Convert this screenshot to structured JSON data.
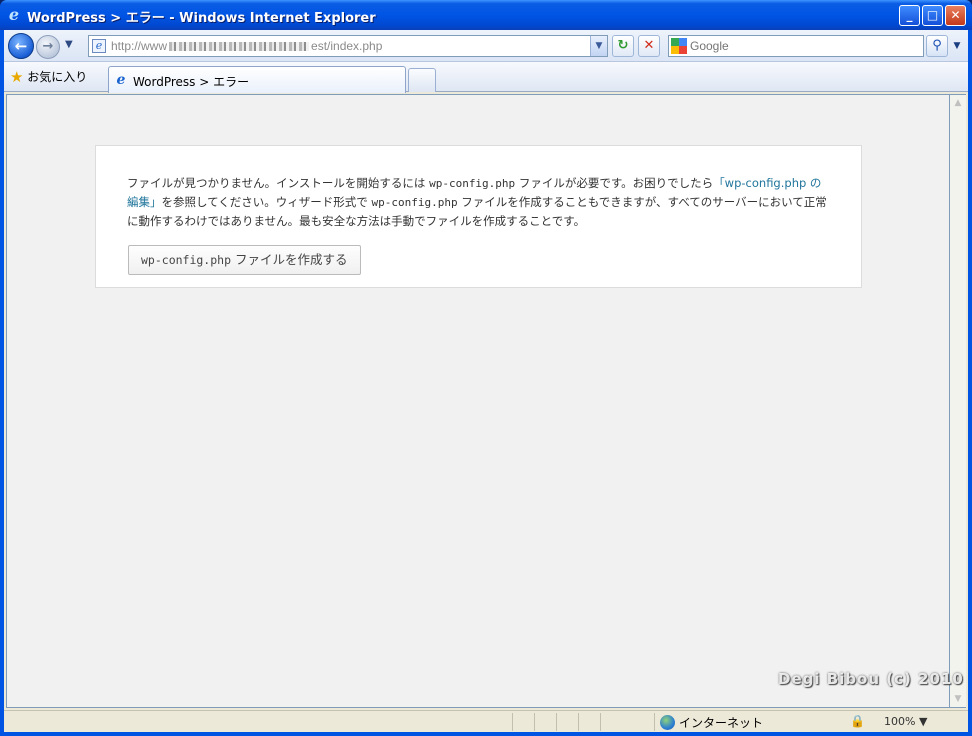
{
  "window": {
    "title": "WordPress > エラー - Windows Internet Explorer",
    "buttons": {
      "minimize": "_",
      "maximize": "□",
      "close": "✕"
    }
  },
  "navbar": {
    "address_prefix": "http://www",
    "address_suffix": "est/index.php",
    "search_placeholder": "Google",
    "back_glyph": "←",
    "forward_glyph": "→",
    "refresh_glyph": "↻",
    "stop_glyph": "✕",
    "search_glyph": "⚲"
  },
  "favorites": {
    "label": "お気に入り",
    "tab_label": "WordPress > エラー"
  },
  "page": {
    "msg_part1": "ファイルが見つかりません。インストールを開始するには ",
    "msg_code1": "wp-config.php",
    "msg_part2": " ファイルが必要です。お困りでしたら",
    "msg_link": "「wp-config.php の編集」",
    "msg_part3": "を参照してください。ウィザード形式で ",
    "msg_code2": "wp-config.php",
    "msg_part4": " ファイルを作成することもできますが、すべてのサーバーにおいて正常に動作するわけではありません。最も安全な方法は手動でファイルを作成することです。",
    "button_code": "wp-config.php",
    "button_text": " ファイルを作成する"
  },
  "statusbar": {
    "zone": "インターネット",
    "zoom": "100%"
  },
  "watermark": "Degi Bibou (c) 2010",
  "colors": {
    "titlebar": "#0055e5",
    "link": "#21759b",
    "page_bg": "#f1f1f1"
  }
}
